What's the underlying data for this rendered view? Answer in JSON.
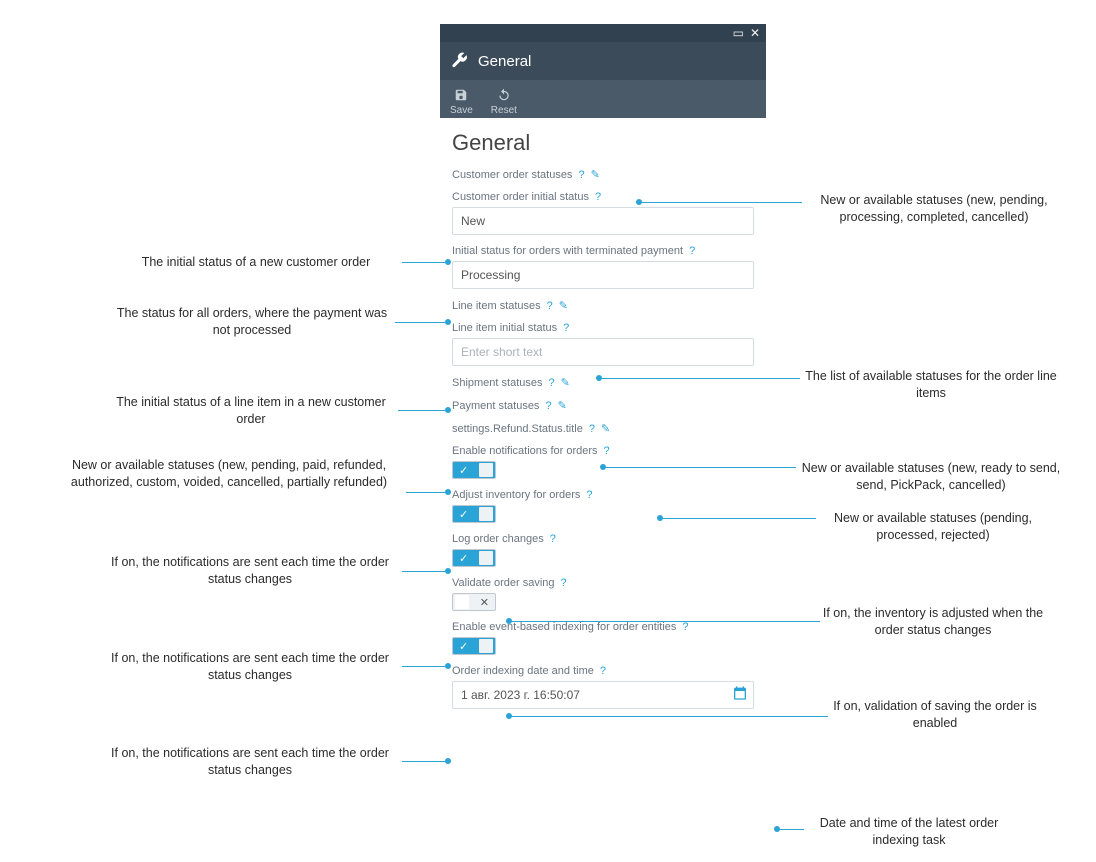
{
  "panel": {
    "header_title": "General",
    "toolbar": {
      "save": "Save",
      "reset": "Reset"
    },
    "heading": "General",
    "fields": {
      "customer_order_statuses": {
        "label": "Customer order statuses"
      },
      "customer_order_initial_status": {
        "label": "Customer order initial status",
        "value": "New"
      },
      "initial_status_terminated_payment": {
        "label": "Initial status for orders with terminated payment",
        "value": "Processing"
      },
      "line_item_statuses": {
        "label": "Line item statuses"
      },
      "line_item_initial_status": {
        "label": "Line item initial status",
        "placeholder": "Enter short text"
      },
      "shipment_statuses": {
        "label": "Shipment statuses"
      },
      "payment_statuses": {
        "label": "Payment statuses"
      },
      "refund_status_title": {
        "label": "settings.Refund.Status.title"
      },
      "enable_notifications": {
        "label": "Enable notifications for orders",
        "value": true
      },
      "adjust_inventory": {
        "label": "Adjust inventory for orders",
        "value": true
      },
      "log_order_changes": {
        "label": "Log order changes",
        "value": true
      },
      "validate_order_saving": {
        "label": "Validate order saving",
        "value": false
      },
      "enable_event_based_indexing": {
        "label": "Enable event-based indexing for order entities",
        "value": true
      },
      "order_indexing_datetime": {
        "label": "Order indexing date and time",
        "value": "1 авг. 2023 г. 16:50:07"
      }
    }
  },
  "callouts": {
    "c1": "New or available statuses (new, pending, processing,  completed, cancelled)",
    "c2": "The initial status of a new customer order",
    "c3": "The status for all orders, where the payment was not processed",
    "c4": "The list of available statuses for the order line items",
    "c5": "The initial status of a line item in a new customer order",
    "c6": "New or available statuses (new, ready to send, send, PickPack, cancelled)",
    "c7": "New or available statuses (new, pending, paid, refunded, authorized, custom, voided, cancelled, partially refunded)",
    "c8": "New or available statuses (pending, processed, rejected)",
    "c9": "If on, the notifications are sent each time the order status changes",
    "c10": "If on, the inventory is adjusted when the order status changes",
    "c11": "If on, the notifications are sent each time the order status changes",
    "c12": "If on, validation of saving the order is enabled",
    "c13": "If on, the notifications are sent each time the order status changes",
    "c14": "Date and time of the latest order indexing task"
  }
}
